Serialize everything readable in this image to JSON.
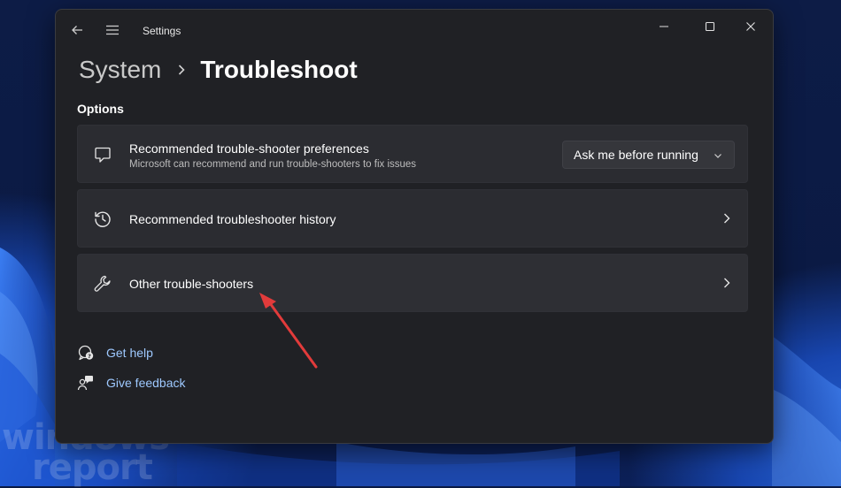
{
  "window": {
    "app_title": "Settings"
  },
  "breadcrumb": {
    "parent": "System",
    "current": "Troubleshoot"
  },
  "section": {
    "title": "Options"
  },
  "cards": [
    {
      "title": "Recommended trouble-shooter preferences",
      "subtitle": "Microsoft can recommend and run trouble-shooters to fix issues",
      "icon": "chat-bubble-icon",
      "dropdown_value": "Ask me before running"
    },
    {
      "title": "Recommended troubleshooter history",
      "icon": "history-icon"
    },
    {
      "title": "Other trouble-shooters",
      "icon": "wrench-icon"
    }
  ],
  "links": {
    "get_help": "Get help",
    "give_feedback": "Give feedback"
  },
  "watermark": {
    "line1": "windows",
    "line2": "report"
  },
  "colors": {
    "window_bg": "#202125",
    "card_bg": "#2b2c31",
    "link": "#9ec9ff",
    "annotation_arrow": "#e23b3b"
  }
}
